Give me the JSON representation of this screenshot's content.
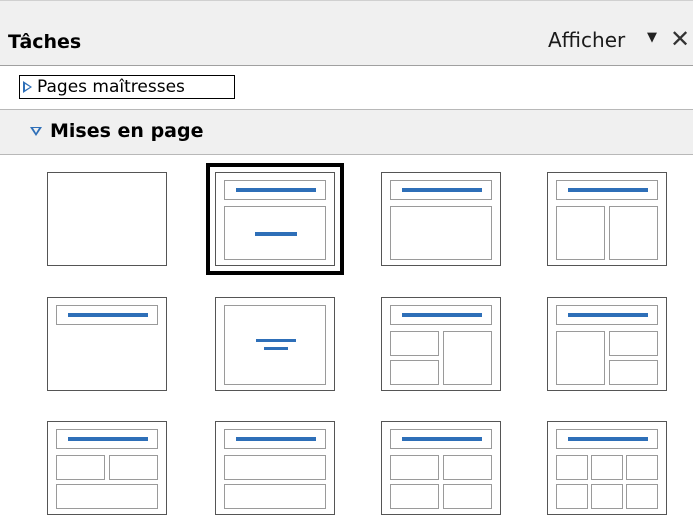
{
  "panel": {
    "title": "Tâches",
    "view_menu_label": "Afficher",
    "view_menu_icon": "triangle-down-icon",
    "close_icon": "close-icon"
  },
  "sections": {
    "master_pages": {
      "label": "Pages maîtresses",
      "expanded": false
    },
    "layouts": {
      "label": "Mises en page",
      "expanded": true
    }
  },
  "layouts": {
    "selected_index": 1,
    "accent_color": "#2e6fb8",
    "items": [
      {
        "id": "blank"
      },
      {
        "id": "title-only-centered"
      },
      {
        "id": "title-content"
      },
      {
        "id": "title-two-content"
      },
      {
        "id": "title-only"
      },
      {
        "id": "centered-text"
      },
      {
        "id": "title-2-content-and-content"
      },
      {
        "id": "title-content-and-2-content"
      },
      {
        "id": "title-2-content-over-content"
      },
      {
        "id": "title-content-over-content"
      },
      {
        "id": "title-2-content-over-2-content"
      },
      {
        "id": "title-6-content"
      }
    ]
  }
}
